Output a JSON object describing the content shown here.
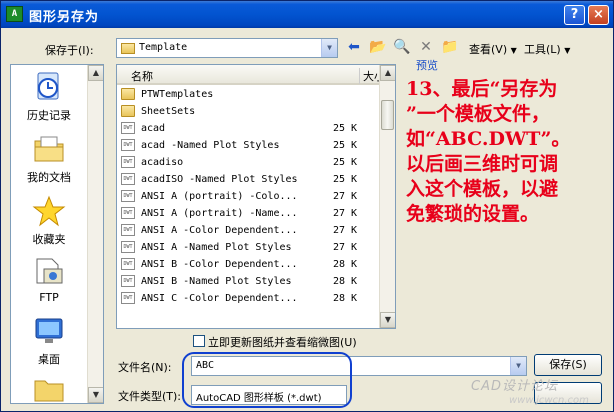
{
  "window": {
    "title": "图形另存为",
    "help_glyph": "?",
    "close_glyph": "×",
    "app_icon_text": "A"
  },
  "toolbar": {
    "save_in_label": "保存于(I):",
    "save_in_value": "Template",
    "view_label": "查看(V)",
    "tools_label": "工具(L)"
  },
  "places": [
    {
      "label": "历史记录",
      "icon": "history-icon"
    },
    {
      "label": "我的文档",
      "icon": "my-documents-icon"
    },
    {
      "label": "收藏夹",
      "icon": "favorites-icon"
    },
    {
      "label": "FTP",
      "icon": "ftp-icon"
    },
    {
      "label": "桌面",
      "icon": "desktop-icon"
    }
  ],
  "file_list": {
    "header_name": "名称",
    "header_size": "大小",
    "rows": [
      {
        "name": "PTWTemplates",
        "size": "",
        "type": "folder"
      },
      {
        "name": "SheetSets",
        "size": "",
        "type": "folder"
      },
      {
        "name": "acad",
        "size": "25 K",
        "type": "dwt"
      },
      {
        "name": "acad -Named Plot Styles",
        "size": "25 K",
        "type": "dwt"
      },
      {
        "name": "acadiso",
        "size": "25 K",
        "type": "dwt"
      },
      {
        "name": "acadISO -Named Plot Styles",
        "size": "25 K",
        "type": "dwt"
      },
      {
        "name": "ANSI A (portrait) -Colo...",
        "size": "27 K",
        "type": "dwt"
      },
      {
        "name": "ANSI A (portrait) -Name...",
        "size": "27 K",
        "type": "dwt"
      },
      {
        "name": "ANSI A -Color Dependent...",
        "size": "27 K",
        "type": "dwt"
      },
      {
        "name": "ANSI A -Named Plot Styles",
        "size": "27 K",
        "type": "dwt"
      },
      {
        "name": "ANSI B -Color Dependent...",
        "size": "28 K",
        "type": "dwt"
      },
      {
        "name": "ANSI B -Named Plot Styles",
        "size": "28 K",
        "type": "dwt"
      },
      {
        "name": "ANSI C -Color Dependent...",
        "size": "28 K",
        "type": "dwt"
      }
    ]
  },
  "preview_label": "预览",
  "annotation": "13、最后“另存为\n”一个模板文件，\n如“ABC.DWT”。\n以后画三维时可调\n入这个模板，以避\n免繁琐的设置。",
  "update_thumbnail_label": "立即更新图纸并查看缩微图(U)",
  "filename": {
    "label": "文件名(N):",
    "value": "ABC"
  },
  "filetype": {
    "label": "文件类型(T):",
    "value": "AutoCAD 图形样板 (*.dwt)"
  },
  "buttons": {
    "save": "保存(S)"
  },
  "watermark": {
    "line1": "CAD设计论坛",
    "line2": "www.jcwcn.com"
  },
  "colors": {
    "title_bar": "#0054e3",
    "annotation": "#e8001a",
    "highlight": "#1040d0"
  }
}
